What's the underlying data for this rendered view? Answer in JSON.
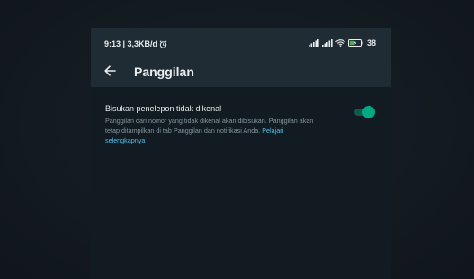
{
  "status_bar": {
    "time_speed": "9:13 | 3,3KB/d",
    "battery_level": "38",
    "icons": [
      "alarm-icon",
      "signal-icon",
      "signal-icon",
      "wifi-icon",
      "battery-icon"
    ]
  },
  "app_bar": {
    "back_icon": "arrow-left-icon",
    "title": "Panggilan"
  },
  "setting": {
    "title": "Bisukan penelepon tidak dikenal",
    "description": "Panggilan dari nomor yang tidak dikenal akan dibisukan. Panggilan akan tetap ditampilkan di tab Panggilan dan notifikasi Anda.",
    "link_text": "Pelajari selengkapnya",
    "toggle_on": true
  },
  "colors": {
    "bar_bg": "#1f2c34",
    "screen_bg": "#111b21",
    "accent": "#00a884",
    "link": "#53bdeb",
    "text_primary": "#e9edef",
    "text_secondary": "#8696a0"
  }
}
